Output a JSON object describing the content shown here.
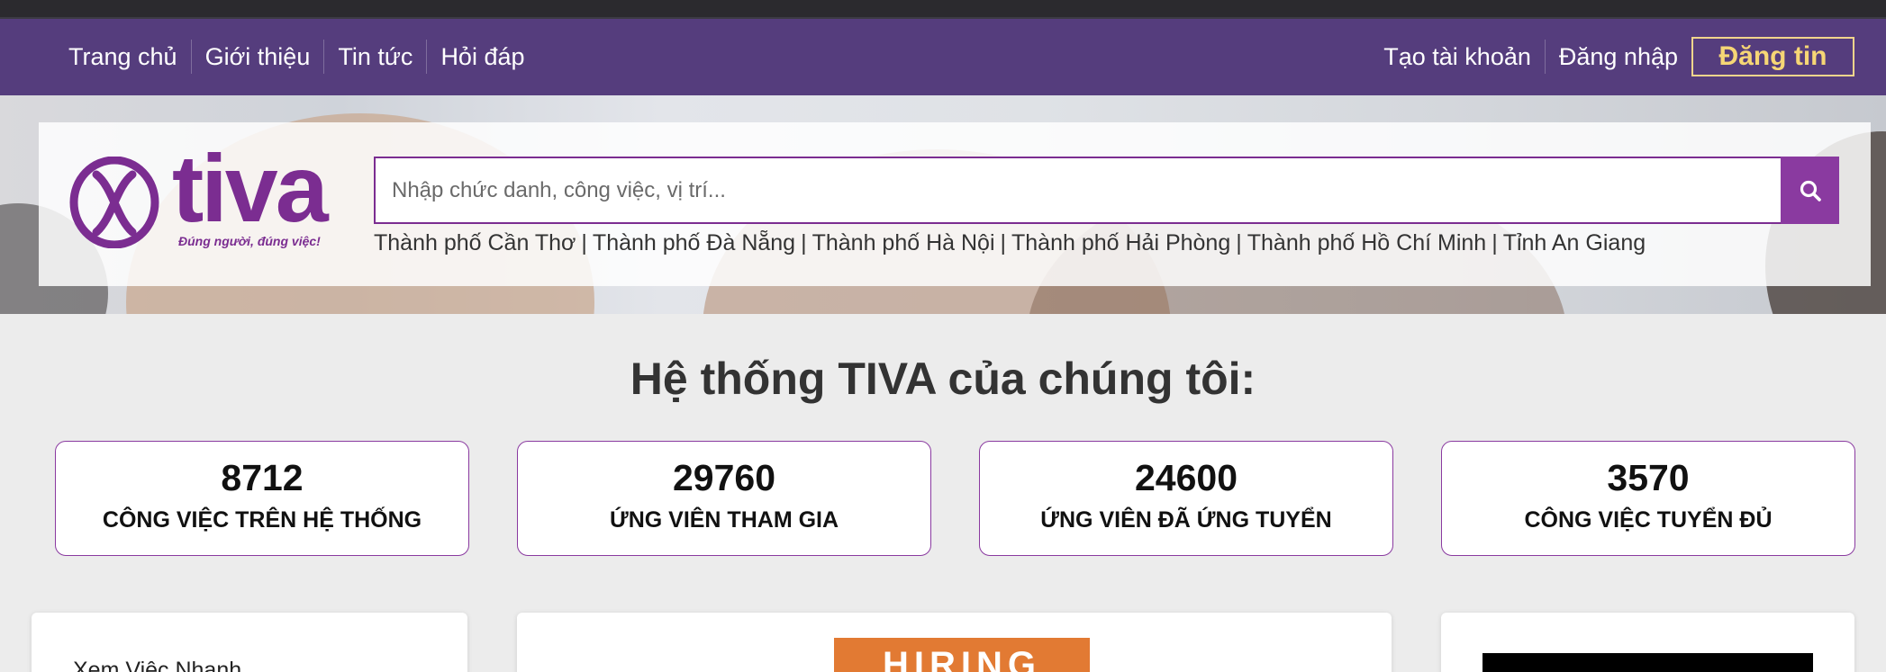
{
  "nav": {
    "links": [
      {
        "label": "Trang chủ"
      },
      {
        "label": "Giới thiệu"
      },
      {
        "label": "Tin tức"
      },
      {
        "label": "Hỏi đáp"
      }
    ],
    "create_account": "Tạo tài khoản",
    "login": "Đăng nhập",
    "post_job": "Đăng tin"
  },
  "logo": {
    "word": "tiva",
    "slogan": "Đúng người, đúng việc!"
  },
  "search": {
    "placeholder": "Nhập chức danh, công việc, vị trí...",
    "icon": "search-icon"
  },
  "cities": [
    "Thành phố Cần Thơ",
    "Thành phố Đà Nẵng",
    "Thành phố Hà Nội",
    "Thành phố Hải Phòng",
    "Thành phố Hồ Chí Minh",
    "Tỉnh An Giang"
  ],
  "city_separator": "|",
  "section_title": "Hệ thống TIVA của chúng tôi:",
  "stats": [
    {
      "value": "8712",
      "label": "CÔNG VIỆC TRÊN HỆ THỐNG"
    },
    {
      "value": "29760",
      "label": "ỨNG VIÊN THAM GIA"
    },
    {
      "value": "24600",
      "label": "ỨNG VIÊN ĐÃ ỨNG TUYỂN"
    },
    {
      "value": "3570",
      "label": "CÔNG VIỆC TUYỂN ĐỦ"
    }
  ],
  "cards": {
    "left_title": "Xem Việc Nhanh",
    "banner_text": "HIRING"
  },
  "colors": {
    "brand_purple": "#553d7d",
    "accent_purple": "#8a3aa0",
    "post_button_gold": "#f6d675",
    "hiring_orange": "#e27a33"
  }
}
